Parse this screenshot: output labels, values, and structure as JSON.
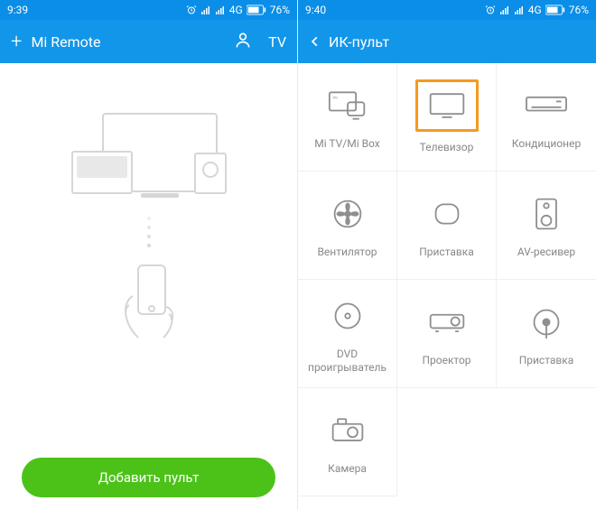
{
  "status": {
    "time_left": "9:39",
    "time_right": "9:40",
    "network": "4G",
    "battery": "76%"
  },
  "screen1": {
    "title": "Mi Remote",
    "tv_label": "TV",
    "add_button": "Добавить пульт"
  },
  "screen2": {
    "title": "ИК-пульт",
    "grid": [
      {
        "label": "Mi TV/Mi Box",
        "icon": "mitv",
        "selected": false
      },
      {
        "label": "Телевизор",
        "icon": "tv",
        "selected": true
      },
      {
        "label": "Кондиционер",
        "icon": "ac",
        "selected": false
      },
      {
        "label": "Вентилятор",
        "icon": "fan",
        "selected": false
      },
      {
        "label": "Приставка",
        "icon": "box",
        "selected": false
      },
      {
        "label": "AV-ресивер",
        "icon": "avr",
        "selected": false
      },
      {
        "label": "DVD проигрыватель",
        "icon": "dvd",
        "selected": false
      },
      {
        "label": "Проектор",
        "icon": "projector",
        "selected": false
      },
      {
        "label": "Приставка",
        "icon": "settop",
        "selected": false
      },
      {
        "label": "Камера",
        "icon": "camera",
        "selected": false
      }
    ]
  },
  "colors": {
    "primary": "#1296e9",
    "accent_green": "#4cc219",
    "accent_orange": "#f59a1e"
  }
}
